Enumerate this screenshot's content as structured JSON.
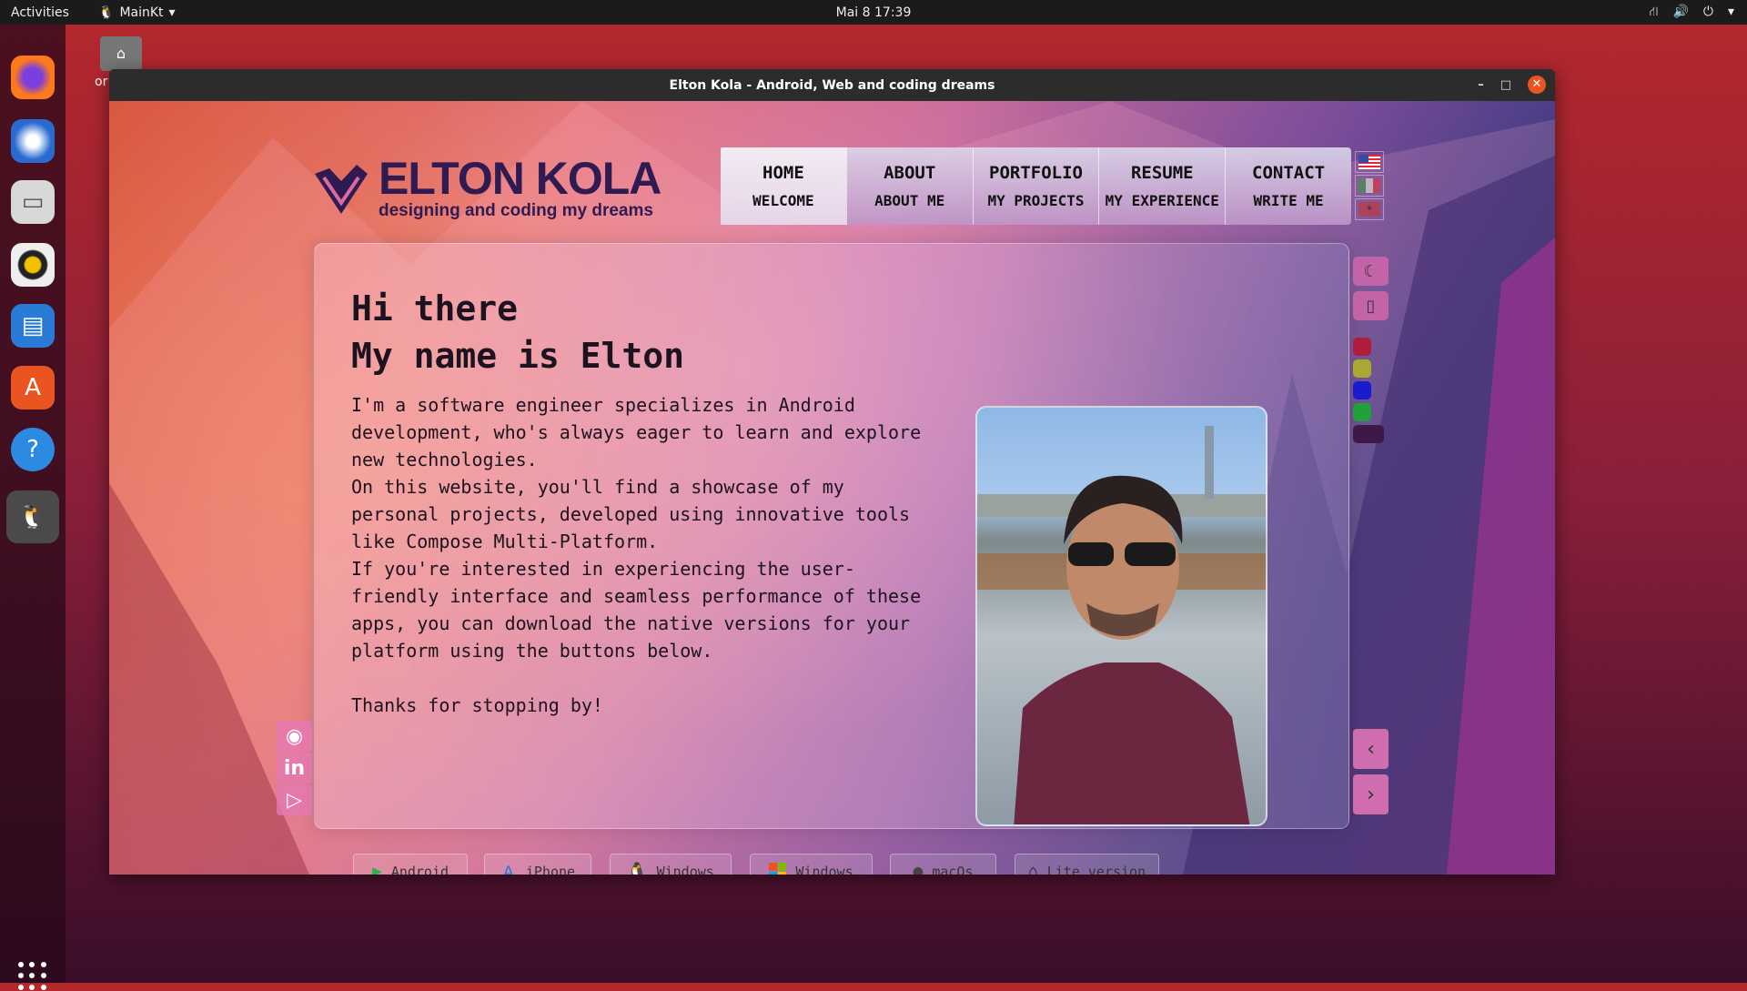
{
  "topbar": {
    "activities": "Activities",
    "app": "MainKt",
    "clock": "Mai 8  17:39"
  },
  "desktop": {
    "folder_label": "or"
  },
  "window": {
    "title": "Elton Kola - Android, Web and coding dreams"
  },
  "site": {
    "logo": {
      "name": "ELTON KOLA",
      "tagline": "designing and coding my dreams"
    },
    "nav": [
      {
        "title": "HOME",
        "subtitle": "WELCOME",
        "active": true
      },
      {
        "title": "ABOUT",
        "subtitle": "ABOUT ME"
      },
      {
        "title": "PORTFOLIO",
        "subtitle": "MY PROJECTS"
      },
      {
        "title": "RESUME",
        "subtitle": "MY EXPERIENCE"
      },
      {
        "title": "CONTACT",
        "subtitle": "WRITE ME"
      }
    ],
    "languages": [
      "en",
      "it",
      "sq"
    ],
    "hero": {
      "line1": "Hi there",
      "line2": "My name is Elton",
      "paragraph": "I'm a software engineer specializes in Android\ndevelopment, who's always eager to learn and explore\nnew technologies.\nOn this website, you'll find a showcase of my\npersonal projects, developed using innovative tools\nlike Compose Multi-Platform.\nIf you're interested in experiencing the user-\nfriendly interface and seamless performance of these\napps, you can download the native versions for your\nplatform using the buttons below.\n\nThanks for stopping by!"
    },
    "downloads": [
      {
        "label": "Android",
        "icon": "google-play-icon"
      },
      {
        "label": "iPhone",
        "icon": "app-store-icon"
      },
      {
        "label": "Windows",
        "icon": "linux-tux-icon"
      },
      {
        "label": "Windows",
        "icon": "windows-icon"
      },
      {
        "label": "macOs",
        "icon": "apple-icon"
      },
      {
        "label": "Lite version",
        "icon": "home-icon"
      }
    ],
    "social": [
      "github",
      "linkedin",
      "google-play"
    ],
    "theme_colors": [
      "#b01c3c",
      "#a8a832",
      "#1a1ad0",
      "#22a03a",
      "#3e1848"
    ]
  }
}
